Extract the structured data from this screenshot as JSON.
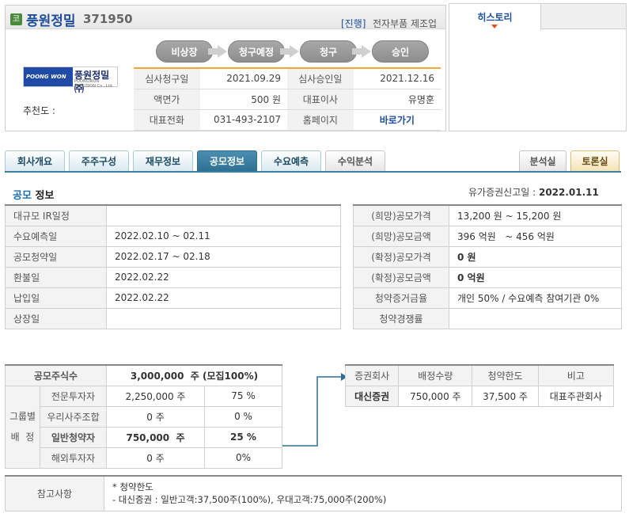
{
  "header": {
    "market_badge": "코",
    "company_name": "풍원정밀",
    "company_code": "371950",
    "status_tag": "[진행]",
    "industry": "전자부품 제조업",
    "steps": [
      "비상장",
      "청구예정",
      "청구",
      "승인"
    ],
    "logo_left": "POONG WON",
    "logo_text": "풍원정밀㈜",
    "logo_sub": "POONGWON PRECISION Co., Ltd.",
    "recommend_label": "추천도 :",
    "info": {
      "review_request_label": "심사청구일",
      "review_request": "2021.09.29",
      "review_approval_label": "심사승인일",
      "review_approval": "2021.12.16",
      "par_value_label": "액면가",
      "par_value": "500 원",
      "ceo_label": "대표이사",
      "ceo": "유명훈",
      "phone_label": "대표전화",
      "phone": "031-493-2107",
      "homepage_label": "홈페이지",
      "homepage": "바로가기"
    }
  },
  "history": {
    "tab_label": "히스토리"
  },
  "tabs": {
    "left": [
      "회사개요",
      "주주구성",
      "재무정보",
      "공모정보",
      "수요예측",
      "수익분석"
    ],
    "active": "공모정보",
    "right": [
      "분석실",
      "토론실"
    ]
  },
  "section": {
    "title_highlight": "공모",
    "title_rest": " 정보",
    "filing_label": "유가증권신고일 :",
    "filing_date": "2022.01.11"
  },
  "schedule": [
    {
      "label": "대규모 IR일정",
      "value": ""
    },
    {
      "label": "수요예측일",
      "value": "2022.02.10 ~ 02.11"
    },
    {
      "label": "공모청약일",
      "value": "2022.02.17 ~ 02.18"
    },
    {
      "label": "환불일",
      "value": "2022.02.22"
    },
    {
      "label": "납입일",
      "value": "2022.02.22"
    },
    {
      "label": "상장일",
      "value": ""
    }
  ],
  "pricing": [
    {
      "label": "(희망)공모가격",
      "value": "13,200 원 ~ 15,200 원"
    },
    {
      "label": "(희망)공모금액",
      "value": "396 억원   ~ 456 억원"
    },
    {
      "label": "(확정)공모가격",
      "value": "0 원"
    },
    {
      "label": "(확정)공모금액",
      "value": "0 억원"
    },
    {
      "label": "청약증거금율",
      "value": "개인 50% / 수요예측 참여기관 0%"
    },
    {
      "label": "청약경쟁률",
      "value": ""
    }
  ],
  "allocation": {
    "total_label": "공모주식수",
    "total_value": "3,000,000  주 (모집100%)",
    "group_label_1": "그룹별",
    "group_label_2": "배  정",
    "rows": [
      {
        "label": "전문투자자",
        "shares": "2,250,000 주",
        "pct": "75 %"
      },
      {
        "label": "우리사주조합",
        "shares": "0 주",
        "pct": "0 %"
      },
      {
        "label": "일반청약자",
        "shares": "750,000  주",
        "pct": "25 %"
      },
      {
        "label": "해외투자자",
        "shares": "0 주",
        "pct": "0%"
      }
    ]
  },
  "underwriters": {
    "headers": [
      "증권회사",
      "배정수량",
      "청약한도",
      "비고"
    ],
    "rows": [
      {
        "firm": "대신증권",
        "qty": "750,000 주",
        "limit": "37,500 주",
        "note": "대표주관회사"
      }
    ]
  },
  "notes": {
    "label": "참고사항",
    "line1": "* 청약한도",
    "line2": "- 대신증권 : 일반고객:37,500주(100%), 우대고객:75,000주(200%)"
  },
  "colors": {
    "accent_blue": "#1e4e9c",
    "tab_active": "#2d6f92",
    "red": "#d32020",
    "rule_orange": "#f0a830"
  }
}
